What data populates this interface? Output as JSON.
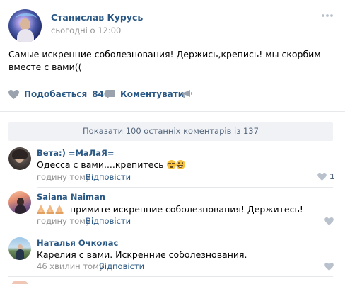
{
  "post": {
    "author": "Станислав Курусь",
    "time": "сьогодні о 12:00",
    "text": "Самые искренние соболезнования! Держись,крепись! мы скорбим вместе с вами((",
    "like_label": "Подобається",
    "like_count": "846",
    "comment_label": "Коментувати"
  },
  "show_comments_label": "Показати 100 останніх коментарів із 137",
  "comments": [
    {
      "author": "Вета:) =МаЛаЯ=",
      "text": "Одесса с вами....крепитесь",
      "time": "годину тому",
      "reply": "Відповісти",
      "likes": "1"
    },
    {
      "author": "Saiana Naiman",
      "text": "примите искренние соболезнования! Держитесь!",
      "time": "годину тому",
      "reply": "Відповісти"
    },
    {
      "author": "Наталья Очколас",
      "text": "Карелия с вами. Искренние соболезнования.",
      "time": "46 хвилин тому",
      "reply": "Відповісти"
    }
  ],
  "colors": {
    "link": "#2a5885",
    "meta": "#939393",
    "icon": "#99a2ad",
    "bar_bg": "#f0f2f5"
  },
  "icons": {
    "more": "more-horizontal-icon",
    "like": "heart-icon",
    "comment": "comment-bubble-icon",
    "share": "megaphone-icon"
  }
}
